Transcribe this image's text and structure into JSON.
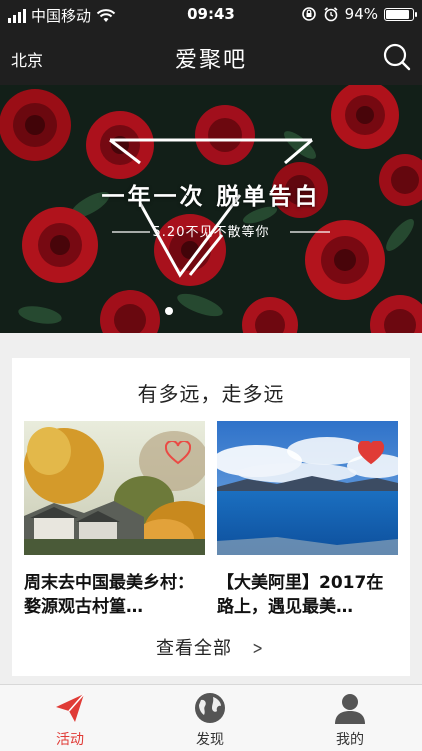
{
  "status_bar": {
    "carrier": "中国移动",
    "time": "09:43",
    "battery": "94%",
    "battery_level": 0.94
  },
  "nav": {
    "city": "北京",
    "title": "爱聚吧",
    "search_icon": "search-icon"
  },
  "banner": {
    "title": "一年一次 脱单告白",
    "subtitle": "5.20不见不散等你"
  },
  "section": {
    "title": "有多远，走多远",
    "items": [
      {
        "text": "周末去中国最美乡村：婺源观古村篁…",
        "favorited": false
      },
      {
        "text": "【大美阿里】2017在路上，遇见最美…",
        "favorited": true
      }
    ],
    "more_label": "查看全部",
    "more_icon": "chevron-right-icon"
  },
  "tabbar": {
    "tabs": [
      {
        "label": "活动",
        "icon": "paper-plane-icon",
        "active": true
      },
      {
        "label": "发现",
        "icon": "globe-icon",
        "active": false
      },
      {
        "label": "我的",
        "icon": "person-icon",
        "active": false
      }
    ]
  },
  "colors": {
    "accent": "#e03b36",
    "bar_bg": "#1f1f1f",
    "page_bg": "#efefef"
  }
}
